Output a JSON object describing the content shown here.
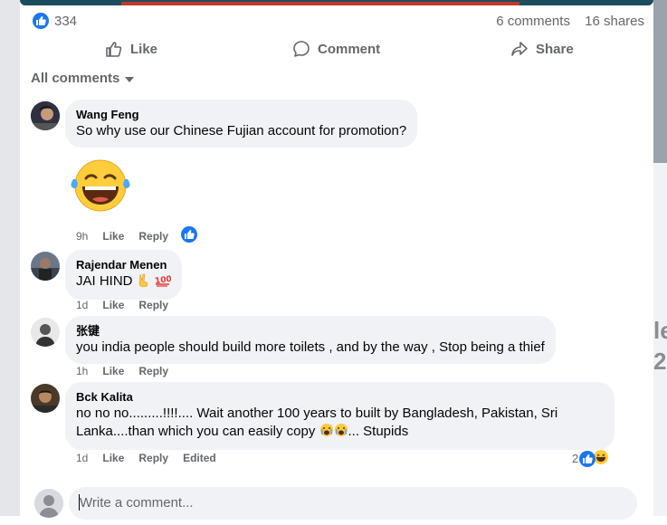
{
  "post_stats": {
    "reaction_count": "334",
    "comments": "6 comments",
    "shares": "16 shares"
  },
  "actions": {
    "like": "Like",
    "comment": "Comment",
    "share": "Share"
  },
  "comments_filter": "All comments",
  "comments": [
    {
      "author": "Wang Feng",
      "text": "So why use our Chinese Fujian account for promotion?",
      "time": "9h",
      "like": "Like",
      "reply": "Reply",
      "sticker": "laughing-tears-emoji"
    },
    {
      "author": "Rajendar Menen",
      "text": "JAI HIND",
      "time": "1d",
      "like": "Like",
      "reply": "Reply"
    },
    {
      "author": "张键",
      "text": "you india people should build more toilets , and by the way , Stop being a thief",
      "time": "1h",
      "like": "Like",
      "reply": "Reply"
    },
    {
      "author": "Bck Kalita",
      "text_line1": "no no no.........!!!!.... Wait another 100 years to built by Bangladesh, Pakistan, Sri",
      "text_line2_a": "Lanka....than which you can easily copy ",
      "text_line2_b": "... Stupids",
      "time": "1d",
      "like": "Like",
      "reply": "Reply",
      "edited": "Edited",
      "reaction_count": "2"
    }
  ],
  "composer": {
    "placeholder": "Write a comment..."
  },
  "background_right_text": "le\n2",
  "colors": {
    "accent": "#1877f2",
    "bubble": "#f0f2f5",
    "muted": "#65676b"
  }
}
